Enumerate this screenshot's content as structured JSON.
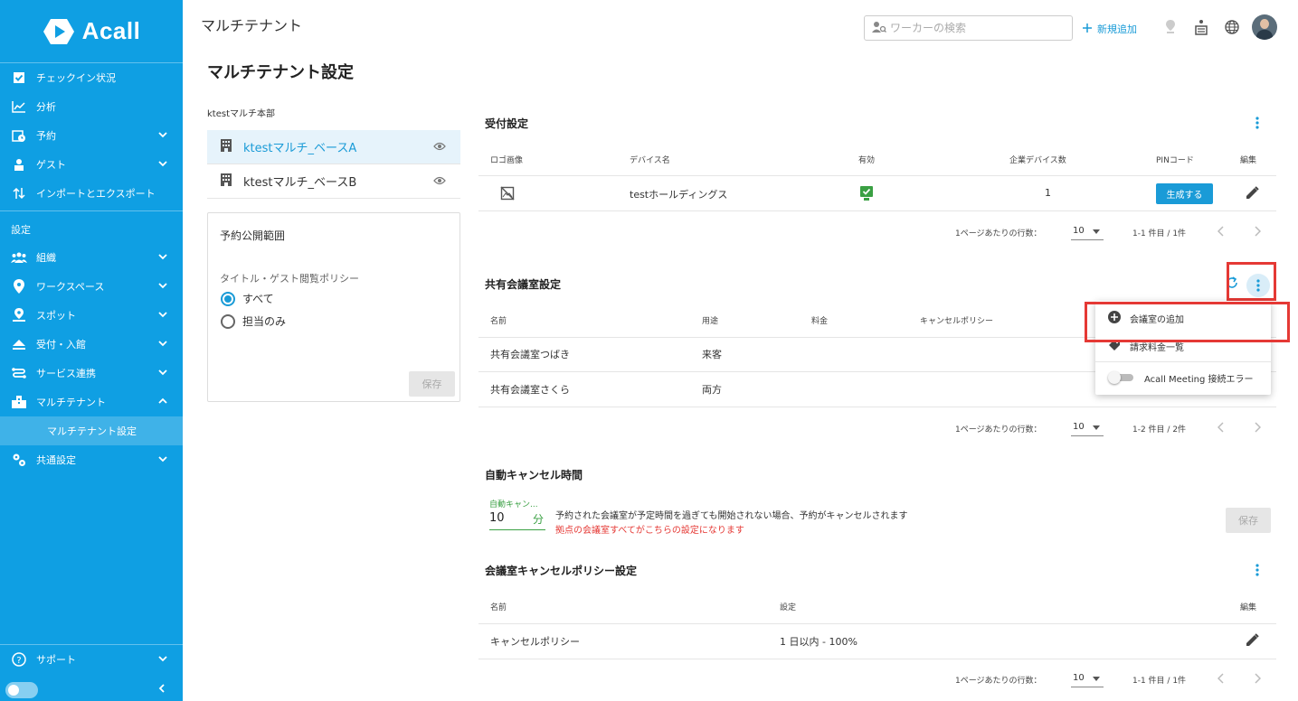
{
  "app": {
    "logo_text": "Acall"
  },
  "sidebar": {
    "items_top": [
      {
        "label": "チェックイン状況",
        "icon": "checkbox-icon"
      },
      {
        "label": "分析",
        "icon": "line-chart-icon"
      },
      {
        "label": "予約",
        "icon": "calendar-clock-icon"
      },
      {
        "label": "ゲスト",
        "icon": "guest-icon"
      },
      {
        "label": "インポートとエクスポート",
        "icon": "import-export-icon"
      }
    ],
    "settings_label": "設定",
    "items_settings": [
      {
        "label": "組織",
        "icon": "people-icon"
      },
      {
        "label": "ワークスペース",
        "icon": "location-pin-icon"
      },
      {
        "label": "スポット",
        "icon": "spot-pin-icon"
      },
      {
        "label": "受付・入館",
        "icon": "eject-icon"
      },
      {
        "label": "サービス連携",
        "icon": "service-link-icon"
      },
      {
        "label": "マルチテナント",
        "icon": "building-icon"
      }
    ],
    "sub_item": "マルチテナント設定",
    "common_settings": "共通設定",
    "support": "サポート"
  },
  "header": {
    "title": "マルチテナント",
    "search_placeholder": "ワーカーの検索",
    "new_label": "新規追加"
  },
  "page": {
    "title": "マルチテナント設定",
    "tenant_group": "ktestマルチ本部",
    "tenants": [
      "ktestマルチ_ベースA",
      "ktestマルチ_ベースB"
    ]
  },
  "reservation_scope": {
    "title": "予約公開範囲",
    "subtitle": "タイトル・ゲスト閲覧ポリシー",
    "options": [
      "すべて",
      "担当のみ"
    ],
    "selected": 0,
    "save": "保存"
  },
  "reception": {
    "title": "受付設定",
    "headers": [
      "ロゴ画像",
      "デバイス名",
      "有効",
      "企業デバイス数",
      "PINコード",
      "編集"
    ],
    "rows": [
      {
        "device": "testホールディングス",
        "count": "1",
        "pin_button": "生成する"
      }
    ],
    "rows_per_page_label": "1ページあたりの行数：",
    "rows_per_page": "10",
    "range": "1-1 件目 / 1件"
  },
  "shared_rooms": {
    "title": "共有会議室設定",
    "headers": [
      "名前",
      "用途",
      "料金",
      "キャンセルポリシー"
    ],
    "rows": [
      {
        "name": "共有会議室つばき",
        "use": "来客"
      },
      {
        "name": "共有会議室さくら",
        "use": "両方"
      }
    ],
    "rows_per_page_label": "1ページあたりの行数：",
    "rows_per_page": "10",
    "range": "1-2 件目 / 2件"
  },
  "menu": {
    "items": [
      "会議室の追加",
      "請求料金一覧",
      "Acall Meeting 接続エラー"
    ]
  },
  "auto_cancel": {
    "title": "自動キャンセル時間",
    "field_label": "自動キャン...",
    "value": "10",
    "unit": "分",
    "desc": "予約された会議室が予定時間を過ぎても開始されない場合、予約がキャンセルされます",
    "note": "拠点の会議室すべてがこちらの設定になります",
    "save": "保存"
  },
  "cancel_policy": {
    "title": "会議室キャンセルポリシー設定",
    "headers": [
      "名前",
      "設定",
      "編集"
    ],
    "rows": [
      {
        "name": "キャンセルポリシー",
        "setting": "1 日以内 - 100%"
      }
    ],
    "rows_per_page_label": "1ページあたりの行数：",
    "rows_per_page": "10",
    "range": "1-1 件目 / 1件"
  },
  "colors": {
    "brand": "#0f9fe3",
    "accent": "#1a9bd7",
    "highlight": "#e53935",
    "success": "#3aa043"
  }
}
